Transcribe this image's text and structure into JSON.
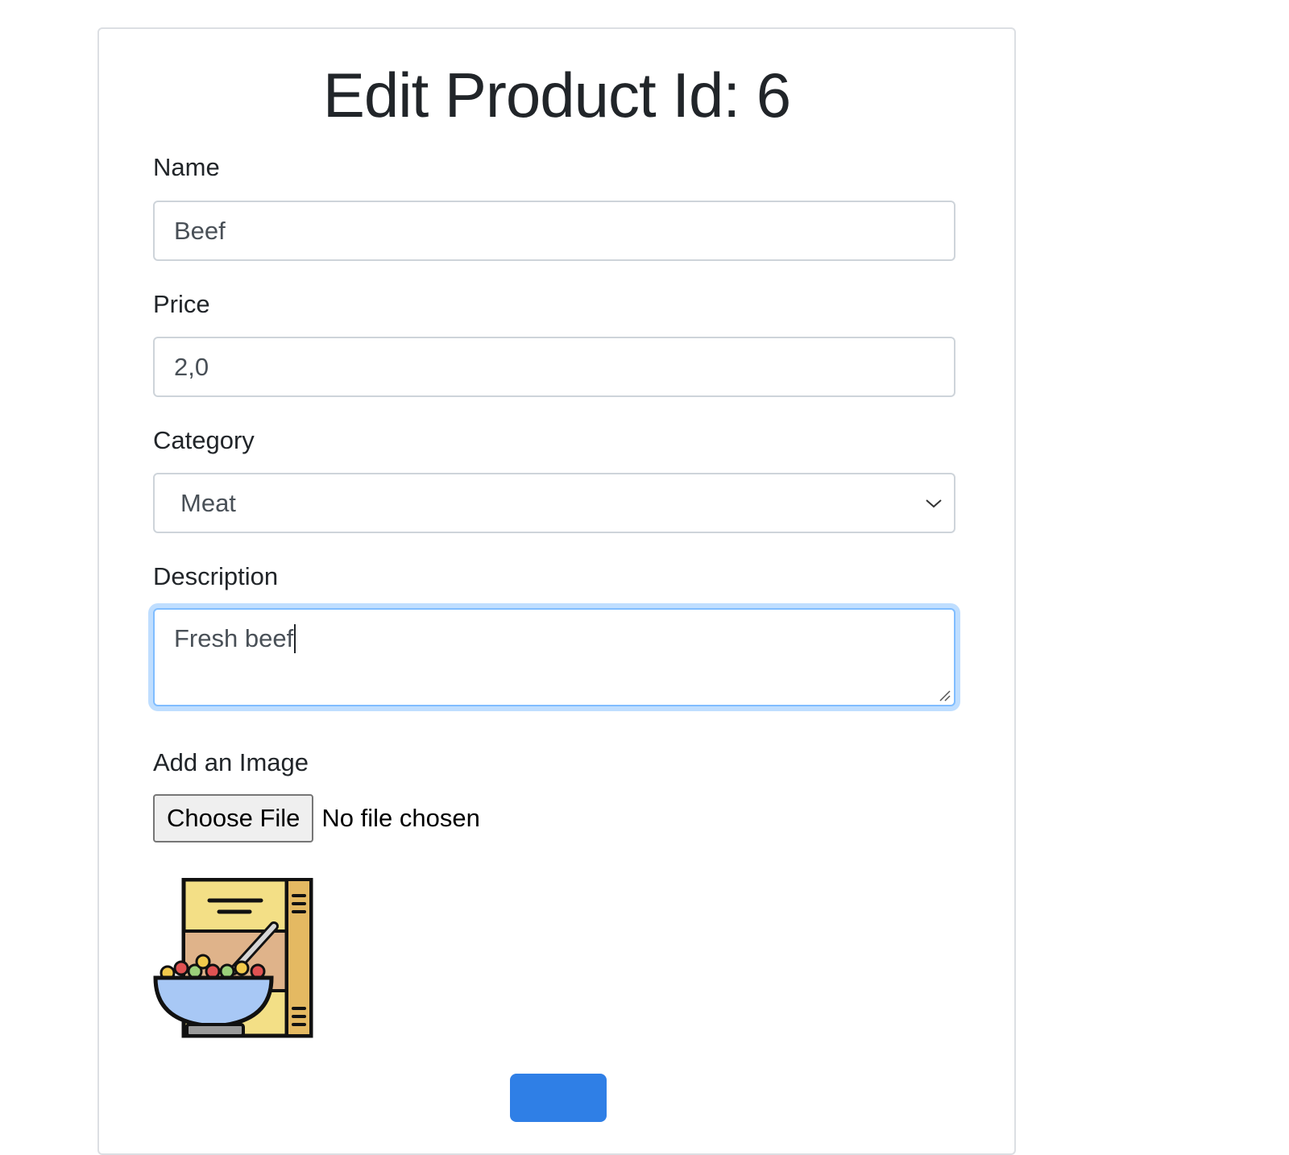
{
  "page": {
    "title": "Edit Product Id: 6"
  },
  "form": {
    "name": {
      "label": "Name",
      "value": "Beef"
    },
    "price": {
      "label": "Price",
      "value": "2,0"
    },
    "category": {
      "label": "Category",
      "selected": "Meat"
    },
    "description": {
      "label": "Description",
      "value": "Fresh beef"
    },
    "image": {
      "label": "Add an Image",
      "choose_button": "Choose File",
      "status": "No file chosen",
      "preview_icon": "cereal-box-bowl-icon"
    },
    "submit_icon": "submit-button"
  },
  "colors": {
    "focus_border": "#80bdff",
    "primary": "#2f7fe6",
    "text": "#212529"
  }
}
